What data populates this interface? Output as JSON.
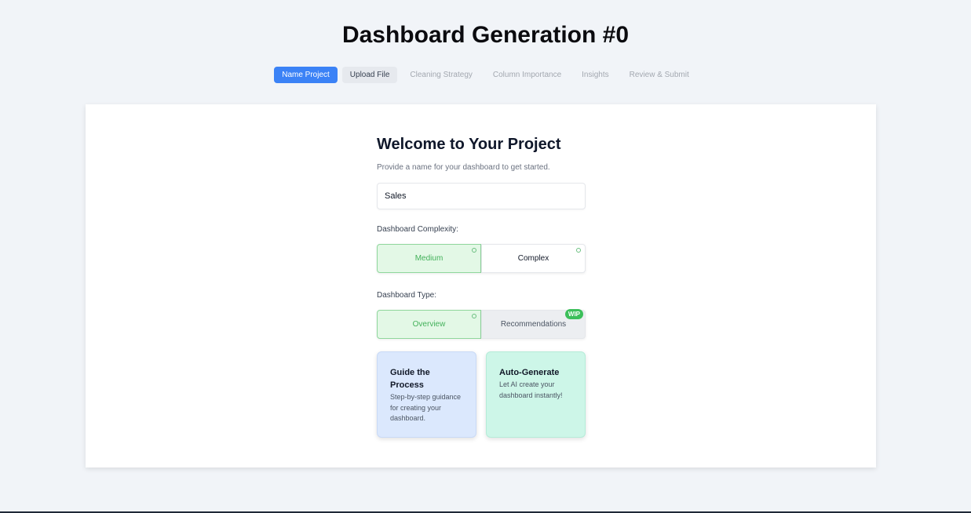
{
  "header": {
    "title": "Dashboard Generation #0"
  },
  "steps": [
    {
      "label": "Name Project",
      "state": "active"
    },
    {
      "label": "Upload File",
      "state": "next"
    },
    {
      "label": "Cleaning Strategy",
      "state": "pending"
    },
    {
      "label": "Column Importance",
      "state": "pending"
    },
    {
      "label": "Insights",
      "state": "pending"
    },
    {
      "label": "Review & Submit",
      "state": "pending"
    }
  ],
  "form": {
    "heading": "Welcome to Your Project",
    "subtext": "Provide a name for your dashboard to get started.",
    "project_name": "Sales",
    "complexity": {
      "label": "Dashboard Complexity:",
      "options": [
        "Medium",
        "Complex"
      ],
      "selected": "Medium"
    },
    "type": {
      "label": "Dashboard Type:",
      "options": [
        "Overview",
        "Recommendations"
      ],
      "selected": "Overview",
      "badge": "WIP"
    }
  },
  "modes": {
    "guide": {
      "title": "Guide the Process",
      "description": "Step-by-step guidance for creating your dashboard."
    },
    "auto": {
      "title": "Auto-Generate",
      "description": "Let AI create your dashboard instantly!"
    }
  },
  "colors": {
    "accent": "#3b82f6",
    "selected_green": "#43b15a",
    "wip_badge": "#3cbf5a",
    "guide_tile": "#dbe8fd",
    "auto_tile": "#cdf6e8"
  }
}
